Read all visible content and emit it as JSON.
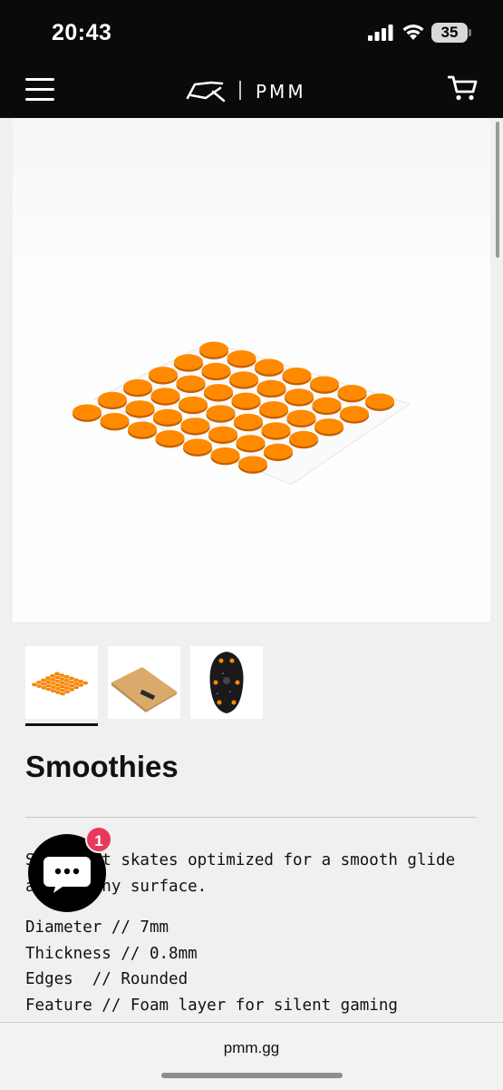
{
  "status_bar": {
    "time": "20:43",
    "battery": "35"
  },
  "header": {
    "logo_text": "PMM"
  },
  "product": {
    "title": "Smoothies",
    "description": "Small dot skates optimized for a smooth glide across any surface.",
    "specs": [
      "Diameter // 7mm",
      "Thickness // 0.8mm",
      "Edges  // Rounded",
      "Feature // Foam layer for silent gaming"
    ]
  },
  "chat": {
    "badge_count": "1"
  },
  "browser": {
    "url": "pmm.gg"
  },
  "colors": {
    "accent_orange": "#ff8a00",
    "badge_red": "#e8395a",
    "header_bg": "#0a0a0a"
  }
}
